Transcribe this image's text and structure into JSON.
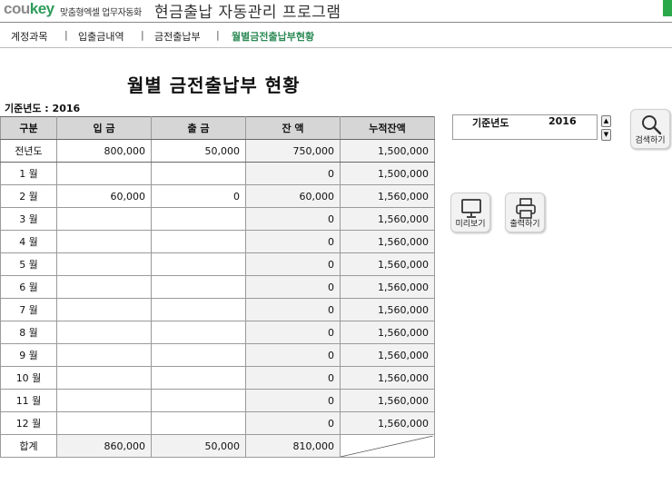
{
  "header": {
    "logo_prefix": "cou",
    "logo_suffix": "key",
    "tagline": "맞춤형엑셀 업무자동화",
    "app_title": "현금출납 자동관리 프로그램"
  },
  "nav": {
    "items": [
      {
        "label": "계정과목"
      },
      {
        "label": "입출금내역"
      },
      {
        "label": "금전출납부"
      },
      {
        "label": "월별금전출납부현황"
      }
    ],
    "separator": "|"
  },
  "page_title": "월별 금전출납부 현황",
  "base_year_label": "기준년도 : 2016",
  "table": {
    "headers": [
      "구분",
      "입 금",
      "출 금",
      "잔 액",
      "누적잔액"
    ],
    "rows": [
      {
        "label": "전년도",
        "deposit": "800,000",
        "withdrawal": "50,000",
        "balance": "750,000",
        "cumulative": "1,500,000"
      },
      {
        "label": "1 월",
        "deposit": "",
        "withdrawal": "",
        "balance": "0",
        "cumulative": "1,500,000"
      },
      {
        "label": "2 월",
        "deposit": "60,000",
        "withdrawal": "0",
        "balance": "60,000",
        "cumulative": "1,560,000"
      },
      {
        "label": "3 월",
        "deposit": "",
        "withdrawal": "",
        "balance": "0",
        "cumulative": "1,560,000"
      },
      {
        "label": "4 월",
        "deposit": "",
        "withdrawal": "",
        "balance": "0",
        "cumulative": "1,560,000"
      },
      {
        "label": "5 월",
        "deposit": "",
        "withdrawal": "",
        "balance": "0",
        "cumulative": "1,560,000"
      },
      {
        "label": "6 월",
        "deposit": "",
        "withdrawal": "",
        "balance": "0",
        "cumulative": "1,560,000"
      },
      {
        "label": "7 월",
        "deposit": "",
        "withdrawal": "",
        "balance": "0",
        "cumulative": "1,560,000"
      },
      {
        "label": "8 월",
        "deposit": "",
        "withdrawal": "",
        "balance": "0",
        "cumulative": "1,560,000"
      },
      {
        "label": "9 월",
        "deposit": "",
        "withdrawal": "",
        "balance": "0",
        "cumulative": "1,560,000"
      },
      {
        "label": "10 월",
        "deposit": "",
        "withdrawal": "",
        "balance": "0",
        "cumulative": "1,560,000"
      },
      {
        "label": "11 월",
        "deposit": "",
        "withdrawal": "",
        "balance": "0",
        "cumulative": "1,560,000"
      },
      {
        "label": "12 월",
        "deposit": "",
        "withdrawal": "",
        "balance": "0",
        "cumulative": "1,560,000"
      }
    ],
    "total": {
      "label": "합계",
      "deposit": "860,000",
      "withdrawal": "50,000",
      "balance": "810,000"
    }
  },
  "controls": {
    "year_label": "기준년도",
    "year_value": "2016",
    "spin_up": "▲",
    "spin_down": "▼",
    "search_label": "검색하기",
    "preview_label": "미리보기",
    "print_label": "출력하기"
  },
  "colors": {
    "accent": "#2aa84a",
    "active_nav": "#2e8b57",
    "header_fill": "#d6d6d6",
    "shaded_cell": "#f2f2f2"
  },
  "icons": [
    "search-icon",
    "monitor-icon",
    "printer-icon"
  ]
}
